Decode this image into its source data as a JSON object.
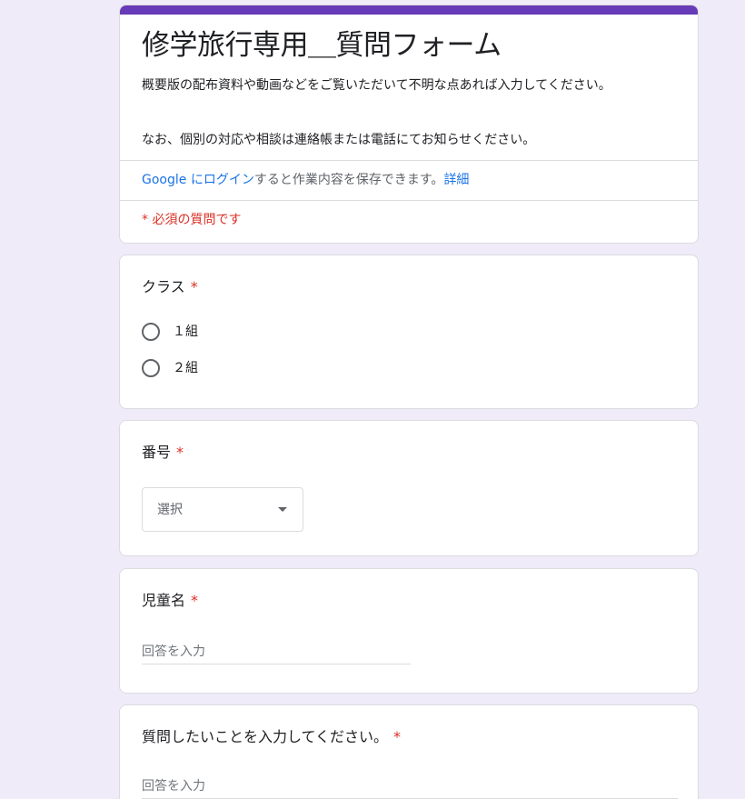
{
  "form": {
    "title": "修学旅行専用＿質問フォーム",
    "description_line1": "概要版の配布資料や動画などをご覧いただいて不明な点あれば入力してください。",
    "description_line2": "なお、個別の対応や相談は連絡帳または電話にてお知らせください。",
    "login_link": "Google にログイン",
    "login_text": "すると作業内容を保存できます。",
    "details_link": "詳細",
    "required_note": "* 必須の質問です",
    "accent_color": "#673ab7"
  },
  "questions": {
    "class": {
      "title": "クラス",
      "required_mark": "*",
      "options": [
        "１組",
        "２組"
      ]
    },
    "number": {
      "title": "番号",
      "required_mark": "*",
      "select_placeholder": "選択"
    },
    "child_name": {
      "title": "児童名",
      "required_mark": "*",
      "placeholder": "回答を入力"
    },
    "question": {
      "title": "質問したいことを入力してください。",
      "required_mark": "*",
      "placeholder": "回答を入力"
    }
  }
}
